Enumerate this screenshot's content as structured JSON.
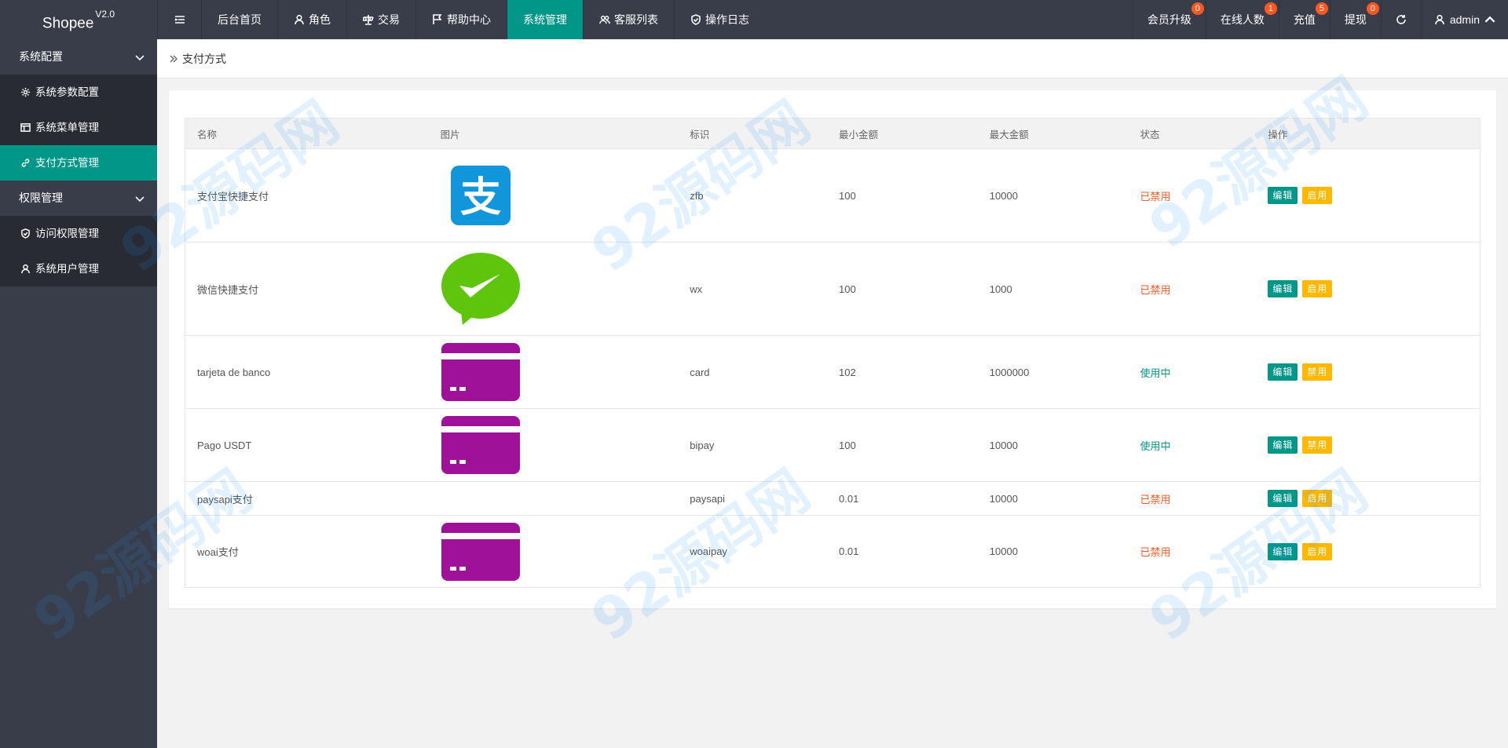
{
  "app": {
    "brand": "Shopee",
    "version": "V2.0"
  },
  "topnav": {
    "items": [
      {
        "label": "后台首页",
        "icon": "home"
      },
      {
        "label": "角色",
        "icon": "user-icon"
      },
      {
        "label": "交易",
        "icon": "scale-icon"
      },
      {
        "label": "帮助中心",
        "icon": "flag-icon"
      },
      {
        "label": "系统管理",
        "icon": "",
        "active": true
      },
      {
        "label": "客服列表",
        "icon": "users-icon"
      },
      {
        "label": "操作日志",
        "icon": "shield-icon"
      }
    ],
    "right": [
      {
        "label": "会员升级",
        "badge": "0"
      },
      {
        "label": "在线人数",
        "badge": "1"
      },
      {
        "label": "充值",
        "badge": "5"
      },
      {
        "label": "提现",
        "badge": "0"
      }
    ],
    "user": "admin"
  },
  "sidebar": {
    "group1": "系统配置",
    "group1_items": [
      "系统参数配置",
      "系统菜单管理",
      "支付方式管理"
    ],
    "group2": "权限管理",
    "group2_items": [
      "访问权限管理",
      "系统用户管理"
    ]
  },
  "breadcrumb": "支付方式",
  "table": {
    "headers": [
      "名称",
      "图片",
      "标识",
      "最小金额",
      "最大金额",
      "状态",
      "操作"
    ],
    "edit_label": "编辑",
    "rows": [
      {
        "name": "支付宝快捷支付",
        "image": "alipay-logo",
        "code": "zfb",
        "min": "100",
        "max": "10000",
        "status": "已禁用",
        "action": "启用"
      },
      {
        "name": "微信快捷支付",
        "image": "wechat-logo",
        "code": "wx",
        "min": "100",
        "max": "1000",
        "status": "已禁用",
        "action": "启用"
      },
      {
        "name": "tarjeta de banco",
        "image": "card-logo",
        "code": "card",
        "min": "102",
        "max": "1000000",
        "status": "使用中",
        "action": "禁用"
      },
      {
        "name": "Pago USDT",
        "image": "card-logo",
        "code": "bipay",
        "min": "100",
        "max": "10000",
        "status": "使用中",
        "action": "禁用"
      },
      {
        "name": "paysapi支付",
        "image": "",
        "code": "paysapi",
        "min": "0.01",
        "max": "10000",
        "status": "已禁用",
        "action": "启用"
      },
      {
        "name": "woai支付",
        "image": "card-logo",
        "code": "woaipay",
        "min": "0.01",
        "max": "10000",
        "status": "已禁用",
        "action": "启用"
      }
    ]
  },
  "colors": {
    "header_bg": "#393d49",
    "accent": "#009688",
    "warn": "#ffb800",
    "danger": "#ff5722"
  },
  "watermark": "92源码网"
}
